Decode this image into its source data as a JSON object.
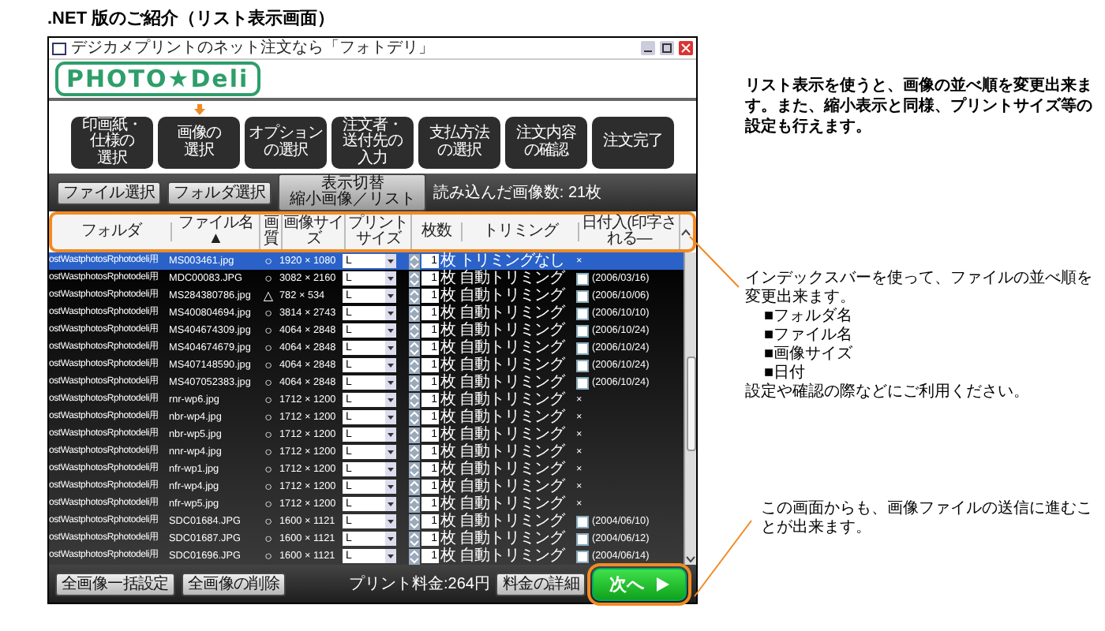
{
  "heading": ".NET 版のご紹介（リスト表示画面）",
  "window": {
    "title": "デジカメプリントのネット注文なら「フォトデリ」",
    "logo": "PHOTO★Deli"
  },
  "steps": [
    {
      "lines": [
        "印画紙・",
        "仕様の",
        "選択"
      ],
      "current": false
    },
    {
      "lines": [
        "画像の",
        "選択"
      ],
      "current": true
    },
    {
      "lines": [
        "オプション",
        "の選択"
      ],
      "current": false
    },
    {
      "lines": [
        "注文者・",
        "送付先の",
        "入力"
      ],
      "current": false
    },
    {
      "lines": [
        "支払方法",
        "の選択"
      ],
      "current": false
    },
    {
      "lines": [
        "注文内容",
        "の確認"
      ],
      "current": false
    },
    {
      "lines": [
        "注文完了"
      ],
      "current": false
    }
  ],
  "toolbar": {
    "buttons": [
      "ファイル選択",
      "フォルダ選択"
    ],
    "view_toggle": {
      "label": "表示切替",
      "sublabel": "縮小画像／リスト"
    },
    "count_text": "読み込んだ画像数: 21枚"
  },
  "table": {
    "columns": [
      "フォルダ",
      "ファイル名 ▲",
      "画質",
      "画像サイズ",
      "プリントサイズ",
      "枚数",
      "トリミング",
      "日付入(印字される—"
    ],
    "rows": [
      {
        "folder": "ostWastphotosRphotodeli用",
        "file": "MS003461.jpg",
        "quality": "○",
        "size": "1920 × 1080",
        "print_size": "L",
        "count": "1",
        "unit": "枚",
        "trimming": "トリミングなし",
        "date": "×",
        "selected": true
      },
      {
        "folder": "ostWastphotosRphotodeli用",
        "file": "MDC00083.JPG",
        "quality": "○",
        "size": "3082 × 2160",
        "print_size": "L",
        "count": "1",
        "unit": "枚",
        "trimming": "自動トリミング",
        "checked": false,
        "date": "(2006/03/16)",
        "selected": false
      },
      {
        "folder": "ostWastphotosRphotodeli用",
        "file": "MS284380786.jpg",
        "quality": "△",
        "size": "782 × 534",
        "print_size": "L",
        "count": "1",
        "unit": "枚",
        "trimming": "自動トリミング",
        "checked": false,
        "date": "(2006/10/06)",
        "selected": false
      },
      {
        "folder": "ostWastphotosRphotodeli用",
        "file": "MS400804694.jpg",
        "quality": "○",
        "size": "3814 × 2743",
        "print_size": "L",
        "count": "1",
        "unit": "枚",
        "trimming": "自動トリミング",
        "checked": false,
        "date": "(2006/10/10)",
        "selected": false
      },
      {
        "folder": "ostWastphotosRphotodeli用",
        "file": "MS404674309.jpg",
        "quality": "○",
        "size": "4064 × 2848",
        "print_size": "L",
        "count": "1",
        "unit": "枚",
        "trimming": "自動トリミング",
        "checked": false,
        "date": "(2006/10/24)",
        "selected": false
      },
      {
        "folder": "ostWastphotosRphotodeli用",
        "file": "MS404674679.jpg",
        "quality": "○",
        "size": "4064 × 2848",
        "print_size": "L",
        "count": "1",
        "unit": "枚",
        "trimming": "自動トリミング",
        "checked": false,
        "date": "(2006/10/24)",
        "selected": false
      },
      {
        "folder": "ostWastphotosRphotodeli用",
        "file": "MS407148590.jpg",
        "quality": "○",
        "size": "4064 × 2848",
        "print_size": "L",
        "count": "1",
        "unit": "枚",
        "trimming": "自動トリミング",
        "checked": false,
        "date": "(2006/10/24)",
        "selected": false
      },
      {
        "folder": "ostWastphotosRphotodeli用",
        "file": "MS407052383.jpg",
        "quality": "○",
        "size": "4064 × 2848",
        "print_size": "L",
        "count": "1",
        "unit": "枚",
        "trimming": "自動トリミング",
        "checked": false,
        "date": "(2006/10/24)",
        "selected": false
      },
      {
        "folder": "ostWastphotosRphotodeli用",
        "file": "rnr-wp6.jpg",
        "quality": "○",
        "size": "1712 × 1200",
        "print_size": "L",
        "count": "1",
        "unit": "枚",
        "trimming": "自動トリミング",
        "date": "×",
        "selected": false
      },
      {
        "folder": "ostWastphotosRphotodeli用",
        "file": "nbr-wp4.jpg",
        "quality": "○",
        "size": "1712 × 1200",
        "print_size": "L",
        "count": "1",
        "unit": "枚",
        "trimming": "自動トリミング",
        "date": "×",
        "selected": false
      },
      {
        "folder": "ostWastphotosRphotodeli用",
        "file": "nbr-wp5.jpg",
        "quality": "○",
        "size": "1712 × 1200",
        "print_size": "L",
        "count": "1",
        "unit": "枚",
        "trimming": "自動トリミング",
        "date": "×",
        "selected": false
      },
      {
        "folder": "ostWastphotosRphotodeli用",
        "file": "nnr-wp4.jpg",
        "quality": "○",
        "size": "1712 × 1200",
        "print_size": "L",
        "count": "1",
        "unit": "枚",
        "trimming": "自動トリミング",
        "date": "×",
        "selected": false
      },
      {
        "folder": "ostWastphotosRphotodeli用",
        "file": "nfr-wp1.jpg",
        "quality": "○",
        "size": "1712 × 1200",
        "print_size": "L",
        "count": "1",
        "unit": "枚",
        "trimming": "自動トリミング",
        "date": "×",
        "selected": false
      },
      {
        "folder": "ostWastphotosRphotodeli用",
        "file": "nfr-wp4.jpg",
        "quality": "○",
        "size": "1712 × 1200",
        "print_size": "L",
        "count": "1",
        "unit": "枚",
        "trimming": "自動トリミング",
        "date": "×",
        "selected": false
      },
      {
        "folder": "ostWastphotosRphotodeli用",
        "file": "nfr-wp5.jpg",
        "quality": "○",
        "size": "1712 × 1200",
        "print_size": "L",
        "count": "1",
        "unit": "枚",
        "trimming": "自動トリミング",
        "date": "×",
        "selected": false
      },
      {
        "folder": "ostWastphotosRphotodeli用",
        "file": "SDC01684.JPG",
        "quality": "○",
        "size": "1600 × 1121",
        "print_size": "L",
        "count": "1",
        "unit": "枚",
        "trimming": "自動トリミング",
        "checked": false,
        "date": "(2004/06/10)",
        "selected": false
      },
      {
        "folder": "ostWastphotosRphotodeli用",
        "file": "SDC01687.JPG",
        "quality": "○",
        "size": "1600 × 1121",
        "print_size": "L",
        "count": "1",
        "unit": "枚",
        "trimming": "自動トリミング",
        "checked": false,
        "date": "(2004/06/12)",
        "selected": false
      },
      {
        "folder": "ostWastphotosRphotodeli用",
        "file": "SDC01696.JPG",
        "quality": "○",
        "size": "1600 × 1121",
        "print_size": "L",
        "count": "1",
        "unit": "枚",
        "trimming": "自動トリミング",
        "checked": false,
        "date": "(2004/06/14)",
        "selected": false
      }
    ]
  },
  "footer": {
    "buttons": [
      "全画像一括設定",
      "全画像の削除"
    ],
    "price": "プリント料金:264円",
    "detail_button": "料金の詳細",
    "next_button": "次へ"
  },
  "notes": [
    {
      "text": "リスト表示を使うと、画像の並べ順を変更出来ます。また、縮小表示と同様、プリントサイズ等の設定も行えます。"
    },
    {
      "text": "インデックスバーを使って、ファイルの並べ順を変更出来ます。",
      "items": [
        "■フォルダ名",
        "■ファイル名",
        "■画像サイズ",
        "■日付"
      ],
      "after": "設定や確認の際などにご利用ください。"
    },
    {
      "text": "この画面からも、画像ファイルの送信に進むことが出来ます。"
    }
  ]
}
